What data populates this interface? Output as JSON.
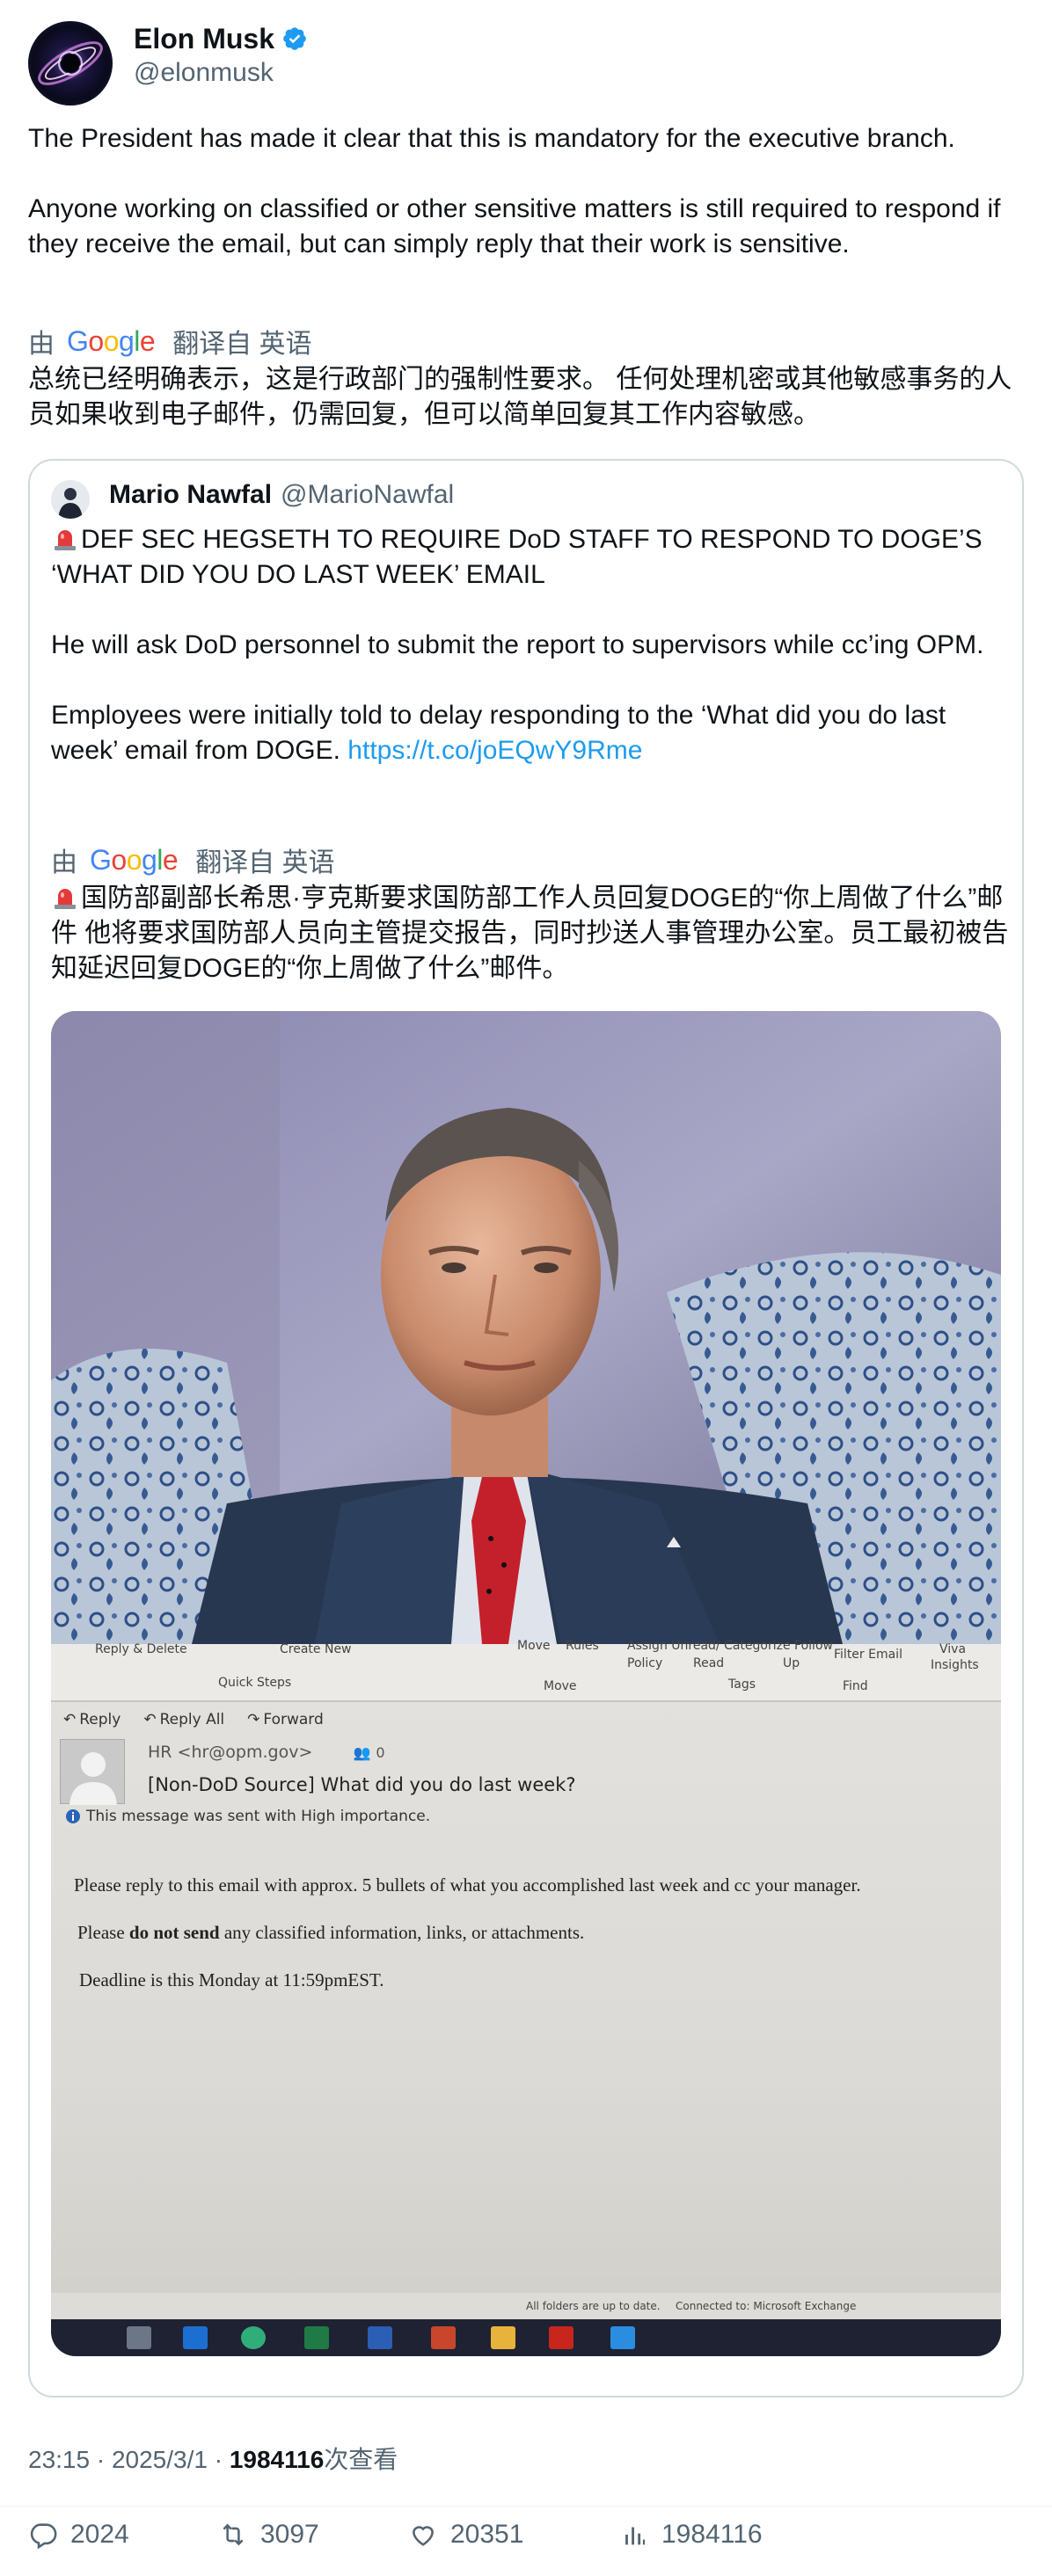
{
  "author": {
    "name": "Elon Musk",
    "handle": "@elonmusk"
  },
  "tweet": {
    "text": "The President has made it clear that this is mandatory for the executive branch.\n\nAnyone working on classified or other sensitive matters is still required to respond if they receive the email, but can simply reply that their work is sensitive."
  },
  "translation": {
    "by_label": "由",
    "provider": "Google",
    "translated_from_label": "翻译自 英语",
    "text": "总统已经明确表示，这是行政部门的强制性要求。 任何处理机密或其他敏感事务的人员如果收到电子邮件，仍需回复，但可以简单回复其工作内容敏感。"
  },
  "quote": {
    "name": "Mario Nawfal",
    "handle": "@MarioNawfal",
    "text_main": "DEF SEC HEGSETH TO REQUIRE DoD STAFF TO RESPOND TO DOGE’S ‘WHAT DID YOU DO LAST WEEK’ EMAIL\n\nHe will ask DoD personnel to submit the report to supervisors while cc’ing OPM.\n\nEmployees were initially told to delay responding to the ‘What did you do last week’ email from DOGE. ",
    "link": "https://t.co/joEQwY9Rme",
    "translation_by_label": "由",
    "translation_provider": "Google",
    "translation_from_label": "翻译自 英语",
    "translation_text": "国防部副部长希思·亨克斯要求国防部工作人员回复DOGE的“你上周做了什么”邮件 他将要求国防部人员向主管提交报告，同时抄送人事管理办公室。员工最初被告知延迟回复DOGE的“你上周做了什么”邮件。"
  },
  "email_image": {
    "ribbon": {
      "reply_delete": "Reply & Delete",
      "create_new": "Create New",
      "quick_steps": "Quick Steps",
      "move": "Move",
      "rules": "Rules",
      "assign_policy": "Assign Unread/ Categorize Follow",
      "policy": "Policy",
      "read": "Read",
      "up": "Up",
      "tags": "Tags",
      "filter_email": "Filter Email",
      "find": "Find",
      "viva": "Viva",
      "insights": "Insights"
    },
    "actions": [
      "Reply",
      "Reply All",
      "Forward"
    ],
    "from": "HR <hr@opm.gov>",
    "people_count": "0",
    "subject": "[Non-DoD Source] What did you do last week?",
    "importance": "This message was sent with High importance.",
    "body_1": "Please reply to this email with approx. 5 bullets of what you accomplished last week and cc your manager.",
    "body_2_pre": "Please ",
    "body_2_bold": "do not send",
    "body_2_post": " any classified information, links, or attachments.",
    "body_3": "Deadline is this Monday at 11:59pmEST.",
    "status_left": "All folders are up to date.",
    "status_right": "Connected to: Microsoft Exchange"
  },
  "meta": {
    "time": "23:15 · 2025/3/1 · ",
    "views_count": "1984116",
    "views_label": "次查看"
  },
  "stats": {
    "replies": "2024",
    "reposts": "3097",
    "likes": "20351",
    "views": "1984116"
  },
  "colors": {
    "text": "#0f1419",
    "secondary": "#536471",
    "link": "#1d9bf0",
    "verified": "#1d9bf0",
    "border": "#cfd9de"
  }
}
